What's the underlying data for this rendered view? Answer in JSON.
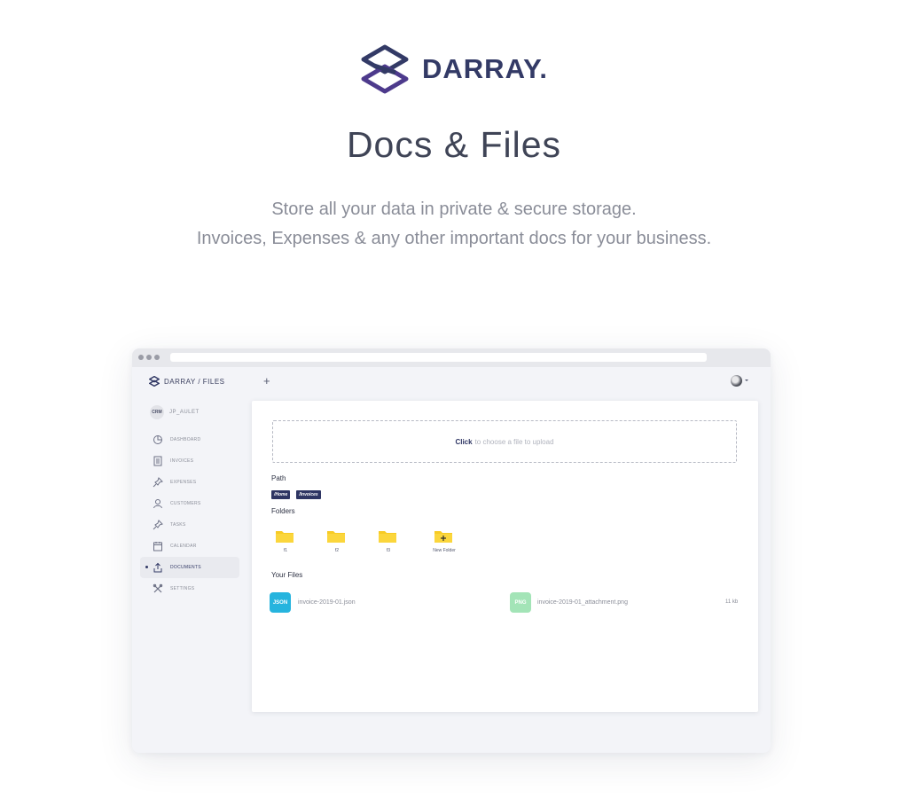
{
  "hero": {
    "brand_name": "DARRAY.",
    "title": "Docs & Files",
    "subtitle_line1": "Store all your data in private & secure storage.",
    "subtitle_line2": "Invoices, Expenses & any other important docs for your business."
  },
  "app": {
    "brand": "DARRAY / FILES",
    "user": {
      "badge": "CRM",
      "name": "JP_AULET"
    },
    "nav": [
      {
        "label": "DASHBOARD",
        "icon": "pie-chart-icon",
        "active": false
      },
      {
        "label": "INVOICES",
        "icon": "document-icon",
        "active": false
      },
      {
        "label": "EXPENSES",
        "icon": "pin-icon",
        "active": false
      },
      {
        "label": "CUSTOMERS",
        "icon": "user-icon",
        "active": false
      },
      {
        "label": "TASKS",
        "icon": "pin-icon",
        "active": false
      },
      {
        "label": "CALENDAR",
        "icon": "calendar-icon",
        "active": false
      },
      {
        "label": "DOCUMENTS",
        "icon": "upload-icon",
        "active": true
      },
      {
        "label": "SETTINGS",
        "icon": "tools-icon",
        "active": false
      }
    ],
    "topbar": {
      "add_icon": "plus-icon",
      "avatar": "user-avatar"
    },
    "upload": {
      "click_label": "Click",
      "hint": "to choose a file to upload"
    },
    "path": {
      "label": "Path",
      "chips": [
        "/Home",
        "/Invoices"
      ]
    },
    "folders": {
      "label": "Folders",
      "items": [
        {
          "label": "f1",
          "type": "folder"
        },
        {
          "label": "f2",
          "type": "folder"
        },
        {
          "label": "f3",
          "type": "folder"
        },
        {
          "label": "New Folder",
          "type": "new-folder"
        }
      ]
    },
    "files": {
      "label": "Your Files",
      "items": [
        {
          "badge": "JSON",
          "name": "invoice-2019-01.json",
          "size": "",
          "color": "#26b4de"
        },
        {
          "badge": "PNG",
          "name": "invoice-2019-01_attachment.png",
          "size": "11 kb",
          "color": "#a3e4b7"
        }
      ]
    }
  },
  "colors": {
    "brand_dark": "#333a66",
    "chip_bg": "#2e3563",
    "folder": "#f7cb25",
    "json_badge": "#26b4de",
    "png_badge": "#a3e4b7"
  }
}
